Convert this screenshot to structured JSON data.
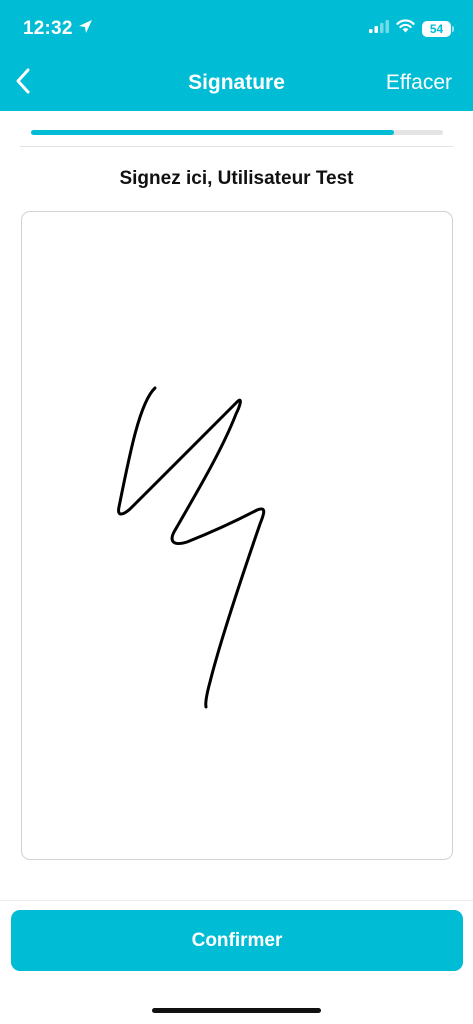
{
  "status_bar": {
    "time": "12:32",
    "battery": "54"
  },
  "header": {
    "title": "Signature",
    "clear_label": "Effacer"
  },
  "progress": {
    "fraction": 0.88
  },
  "signature_pad": {
    "prompt": "Signez ici, Utilisateur Test"
  },
  "footer": {
    "confirm_label": "Confirmer"
  },
  "colors": {
    "accent": "#00bcd4",
    "ink": "#000000"
  },
  "icons": [
    "location-arrow-icon",
    "cellular-signal-icon",
    "wifi-icon",
    "battery-icon",
    "back-chevron-icon"
  ]
}
